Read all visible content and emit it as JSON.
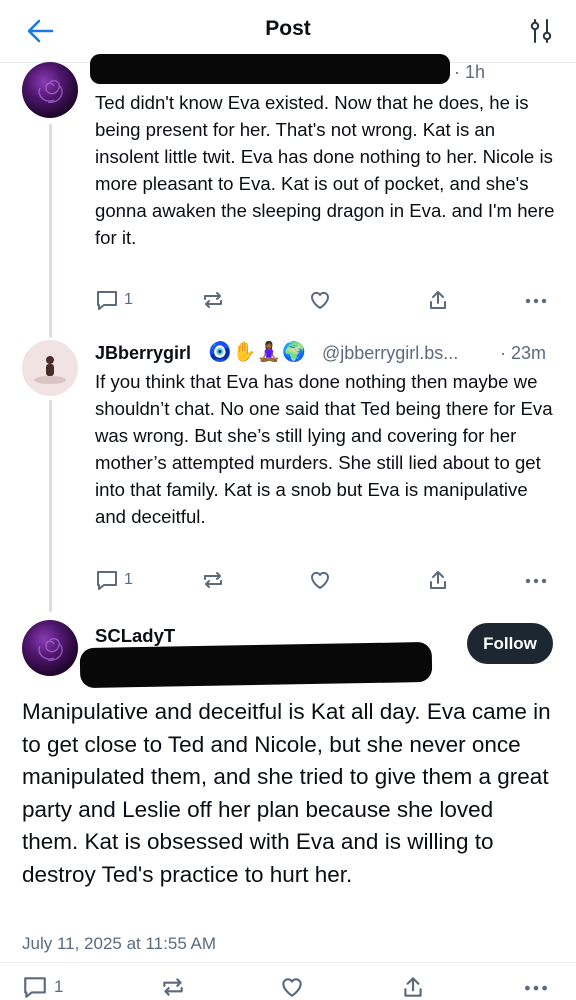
{
  "header": {
    "title": "Post"
  },
  "replies": [
    {
      "time": "· 1h",
      "text": "Ted didn't know Eva existed. Now that he does, he is being present for her. That's not wrong. Kat is an insolent little twit.  Eva has done nothing to her. Nicole is more pleasant to Eva. Kat is out of pocket, and she's gonna awaken the sleeping dragon in Eva. and I'm here for it.",
      "reply_count": "1"
    },
    {
      "display_name": "JBberrygirl",
      "emoji": "🧿✋🧘🏾‍♀️🌍",
      "handle": "@jbberrygirl.bs...",
      "time": "· 23m",
      "text": "If you think that Eva has done nothing then maybe we shouldn’t chat. No one said that Ted being there for Eva was wrong. But she’s still lying and covering for her mother’s attempted murders. She still lied about to get into that family. Kat is a snob but Eva is manipulative and deceitful.",
      "reply_count": "1"
    }
  ],
  "main_post": {
    "display_name": "SCLadyT",
    "follow_label": "Follow",
    "text": "Manipulative and deceitful is Kat all day.  Eva came in to get close to Ted and Nicole, but she never once manipulated them, and she tried to give them a great party and Leslie off her plan because she loved them. Kat is obsessed with Eva and is willing to destroy Ted's practice to hurt her.",
    "date": "July 11, 2025 at 11:55 AM",
    "reply_count": "1"
  },
  "icons": [
    "back-arrow-icon",
    "settings-sliders-icon",
    "reply-icon",
    "repost-icon",
    "like-icon",
    "share-icon",
    "more-icon"
  ],
  "colors": {
    "muted": "#5b6b7d",
    "follow_bg": "#1c2732",
    "thread_line": "#d9dee4"
  }
}
